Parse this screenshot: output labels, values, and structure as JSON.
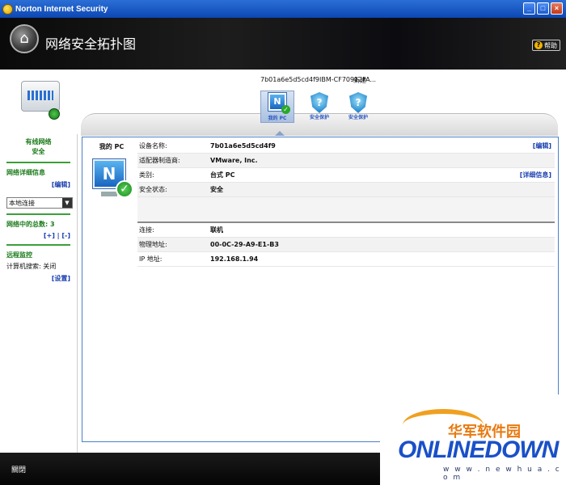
{
  "app_title": "Norton Internet Security",
  "window_buttons": [
    "_",
    "□",
    "×"
  ],
  "header": {
    "title": "网络安全拓扑图",
    "help_label": "帮助"
  },
  "topology": {
    "network_label": "7b01a6e5d5cd4f9IBM-CF70912FA...",
    "new_label": "新建",
    "devices": [
      {
        "label": "我的 PC",
        "icon": "pc-icon",
        "selected": true
      },
      {
        "label": "安全保护",
        "icon": "shield-question-icon",
        "selected": false
      },
      {
        "label": "安全保护",
        "icon": "shield-question-icon",
        "selected": false
      }
    ]
  },
  "left": {
    "status_line1": "有线网络",
    "status_line2": "安全",
    "details_title": "网络详细信息",
    "edit_link": "[编辑]",
    "connection_select": "本地连接",
    "total_label": "网络中的总数: 3",
    "plus_minus": "[+] | [-]",
    "remote_title": "远程监控",
    "remote_status": "计算机搜索: 关闭",
    "settings_link": "[设置]"
  },
  "main": {
    "pc_caption": "我的 PC",
    "rows_top": [
      {
        "key": "设备名称:",
        "value": "7b01a6e5d5cd4f9",
        "action": "[编辑]"
      },
      {
        "key": "适配器制造商:",
        "value": "VMware, Inc.",
        "action": ""
      },
      {
        "key": "类别:",
        "value": "台式 PC",
        "action": "[详细信息]"
      },
      {
        "key": "安全状态:",
        "value": "安全",
        "action": ""
      }
    ],
    "rows_bottom": [
      {
        "key": "连接:",
        "value": "联机",
        "action": ""
      },
      {
        "key": "物理地址:",
        "value": "00-0C-29-A9-E1-B3",
        "action": ""
      },
      {
        "key": "IP 地址:",
        "value": "192.168.1.94",
        "action": ""
      }
    ]
  },
  "footer": {
    "close_label": "關閉"
  },
  "watermark": {
    "cn": "华军软件园",
    "en": "ONLINEDOWN",
    "url": "w w w . n e w h u a . c o m"
  }
}
